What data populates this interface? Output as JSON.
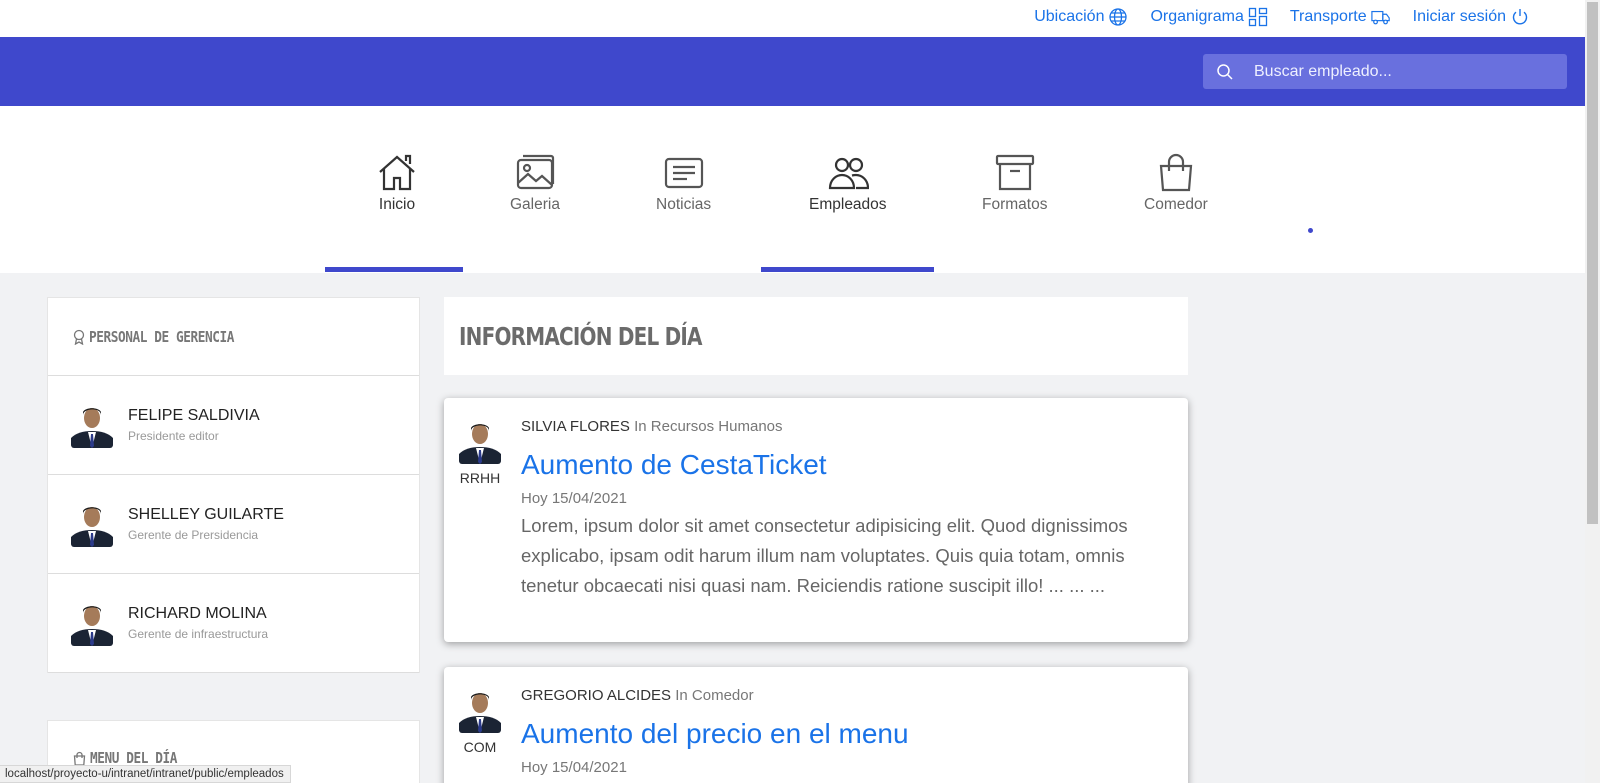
{
  "topbar": {
    "links": [
      {
        "label": "Ubicación",
        "icon": "globe-icon"
      },
      {
        "label": "Organigrama",
        "icon": "grid-icon"
      },
      {
        "label": "Transporte",
        "icon": "truck-icon"
      },
      {
        "label": "Iniciar sesión",
        "icon": "power-icon"
      }
    ]
  },
  "header": {
    "search_placeholder": "Buscar empleado...",
    "accent_color": "#3f48cc",
    "link_color": "#1a73e8"
  },
  "nav": {
    "items": [
      {
        "label": "Inicio",
        "icon": "home-icon",
        "active": true
      },
      {
        "label": "Galeria",
        "icon": "image-icon",
        "active": false
      },
      {
        "label": "Noticias",
        "icon": "news-icon",
        "active": false
      },
      {
        "label": "Empleados",
        "icon": "people-icon",
        "active": true
      },
      {
        "label": "Formatos",
        "icon": "archive-icon",
        "active": false
      },
      {
        "label": "Comedor",
        "icon": "bag-icon",
        "active": false
      }
    ]
  },
  "sidebar": {
    "management_title": "PERSONAL DE GERENCIA",
    "people": [
      {
        "name": "FELIPE SALDIVIA",
        "role": "Presidente editor"
      },
      {
        "name": "SHELLEY GUILARTE",
        "role": "Gerente de Prersidencia"
      },
      {
        "name": "RICHARD MOLINA",
        "role": "Gerente de infraestructura"
      }
    ],
    "menu_title": "MENU DEL DÍA"
  },
  "main": {
    "section_title": "INFORMACIÓN DEL DÍA",
    "posts": [
      {
        "author": "SILVIA FLORES",
        "category": "In Recursos Humanos",
        "dept": "RRHH",
        "title": "Aumento de CestaTicket",
        "date": "Hoy 15/04/2021",
        "excerpt": "Lorem, ipsum dolor sit amet consectetur adipisicing elit. Quod dignissimos explicabo, ipsam odit harum illum nam voluptates. Quis quia totam, omnis tenetur obcaecati nisi quasi nam. Reiciendis ratione suscipit illo! ... ... ..."
      },
      {
        "author": "GREGORIO ALCIDES",
        "category": "In Comedor",
        "dept": "COM",
        "title": "Aumento del precio en el menu",
        "date": "Hoy 15/04/2021"
      }
    ]
  },
  "statusbar": {
    "url": "localhost/proyecto-u/intranet/intranet/public/empleados"
  }
}
